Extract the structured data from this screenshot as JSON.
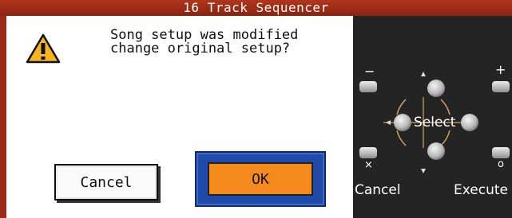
{
  "window": {
    "title": "16 Track Sequencer"
  },
  "dialog": {
    "icon": "warning-icon",
    "message": "Song setup was modified\nchange original setup?",
    "cancel_label": "Cancel",
    "ok_label": "OK"
  },
  "panel": {
    "minus_label": "−",
    "plus_label": "+",
    "select_label": "Select",
    "cancel_symbol": "×",
    "execute_symbol": "o",
    "cancel_label": "Cancel",
    "execute_label": "Execute"
  },
  "colors": {
    "frame": "#9a2a14",
    "ok_button": "#f48a1c",
    "ok_focus": "#1f4aa8",
    "panel": "#242424"
  }
}
